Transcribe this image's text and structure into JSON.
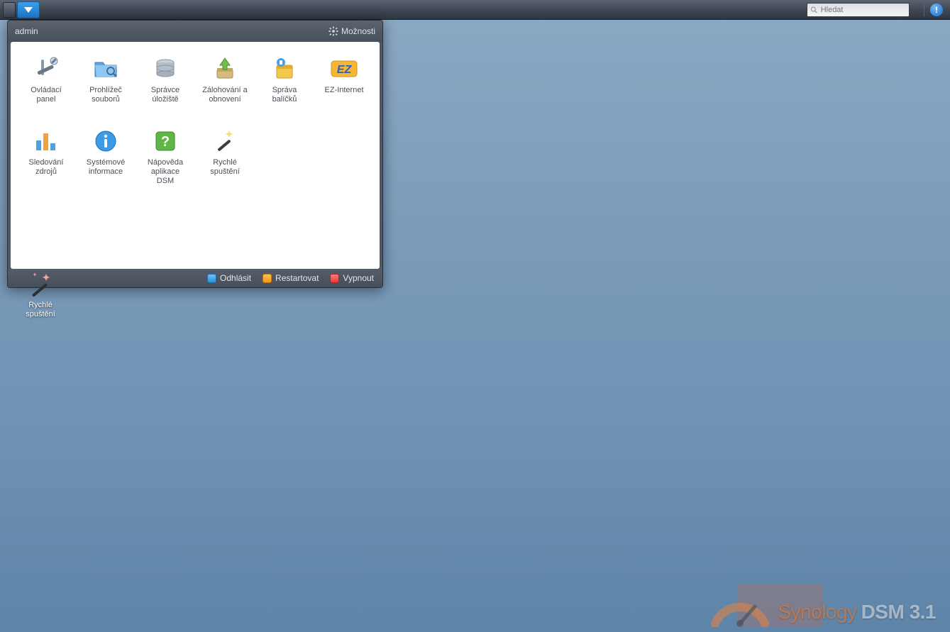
{
  "taskbar": {
    "search_placeholder": "Hledat"
  },
  "start_menu": {
    "user": "admin",
    "options_label": "Možnosti",
    "apps_row1": [
      {
        "line1": "Ovládací",
        "line2": "panel",
        "icon": "control-panel"
      },
      {
        "line1": "Prohlížeč",
        "line2": "souborů",
        "icon": "file-browser"
      },
      {
        "line1": "Správce",
        "line2": "úložiště",
        "icon": "storage-manager"
      },
      {
        "line1": "Zálohování a",
        "line2": "obnovení",
        "icon": "backup"
      },
      {
        "line1": "Správa",
        "line2": "balíčků",
        "icon": "package-center"
      },
      {
        "line1": "EZ-Internet",
        "line2": "",
        "icon": "ez-internet"
      }
    ],
    "apps_row2": [
      {
        "line1": "Sledování",
        "line2": "zdrojů",
        "icon": "resource-monitor"
      },
      {
        "line1": "Systémové",
        "line2": "informace",
        "icon": "system-info"
      },
      {
        "line1": "Nápověda",
        "line2": "aplikace",
        "line3": "DSM",
        "icon": "help"
      },
      {
        "line1": "Rychlé",
        "line2": "spuštění",
        "icon": "quick-start"
      }
    ],
    "footer": {
      "logout": "Odhlásit",
      "restart": "Restartovat",
      "shutdown": "Vypnout"
    }
  },
  "desktop": {
    "quick_start": {
      "line1": "Rychlé",
      "line2": "spuštění"
    }
  },
  "watermark": {
    "brand": "Synology",
    "product": "DSM 3.1"
  }
}
